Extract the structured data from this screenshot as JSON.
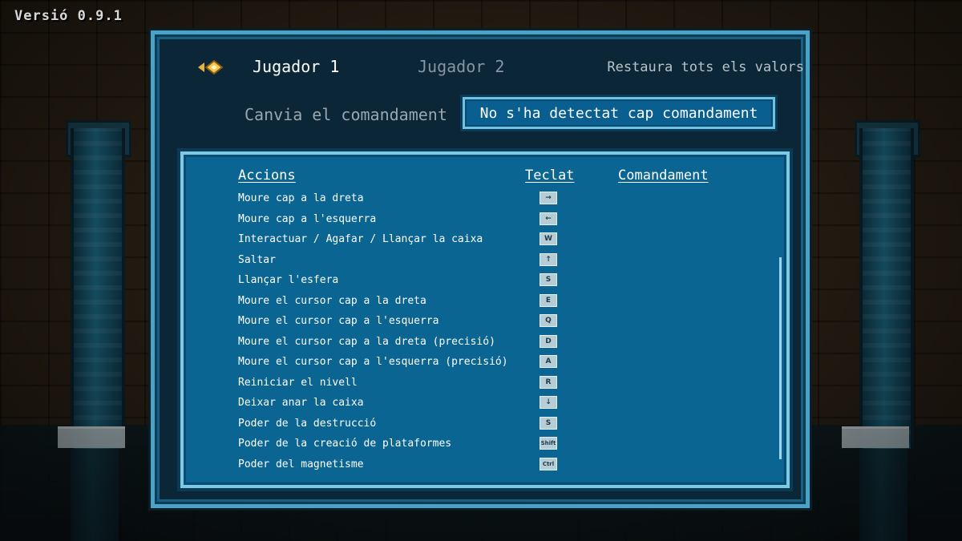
{
  "version": "Versió 0.9.1",
  "tabs": [
    {
      "label": "Jugador 1",
      "active": true
    },
    {
      "label": "Jugador 2",
      "active": false
    }
  ],
  "reset_label": "Restaura tots els valors",
  "controller": {
    "label": "Canvia el comandament",
    "status": "No s'ha detectat cap comandament"
  },
  "table": {
    "headers": {
      "actions": "Accions",
      "keyboard": "Teclat",
      "controller": "Comandament"
    },
    "rows": [
      {
        "action": "Moure cap a la dreta",
        "key": "→"
      },
      {
        "action": "Moure cap a l'esquerra",
        "key": "←"
      },
      {
        "action": "Interactuar / Agafar / Llançar la caixa",
        "key": "W"
      },
      {
        "action": "Saltar",
        "key": "↑"
      },
      {
        "action": "Llançar l'esfera",
        "key": "S"
      },
      {
        "action": "Moure el cursor cap a la dreta",
        "key": "E"
      },
      {
        "action": "Moure el cursor cap a l'esquerra",
        "key": "Q"
      },
      {
        "action": "Moure el cursor cap a la dreta (precisió)",
        "key": "D"
      },
      {
        "action": "Moure el cursor cap a l'esquerra (precisió)",
        "key": "A"
      },
      {
        "action": "Reiniciar el nivell",
        "key": "R"
      },
      {
        "action": "Deixar anar la caixa",
        "key": "↓"
      },
      {
        "action": "Poder de la destrucció",
        "key": "S"
      },
      {
        "action": "Poder de la creació de plataformes",
        "key": "Shift"
      },
      {
        "action": "Poder del magnetisme",
        "key": "Ctrl"
      }
    ]
  },
  "colors": {
    "panel_border": "#4aa3c6",
    "table_bg": "#0a6593",
    "accent_gold": "#e8b33a"
  }
}
